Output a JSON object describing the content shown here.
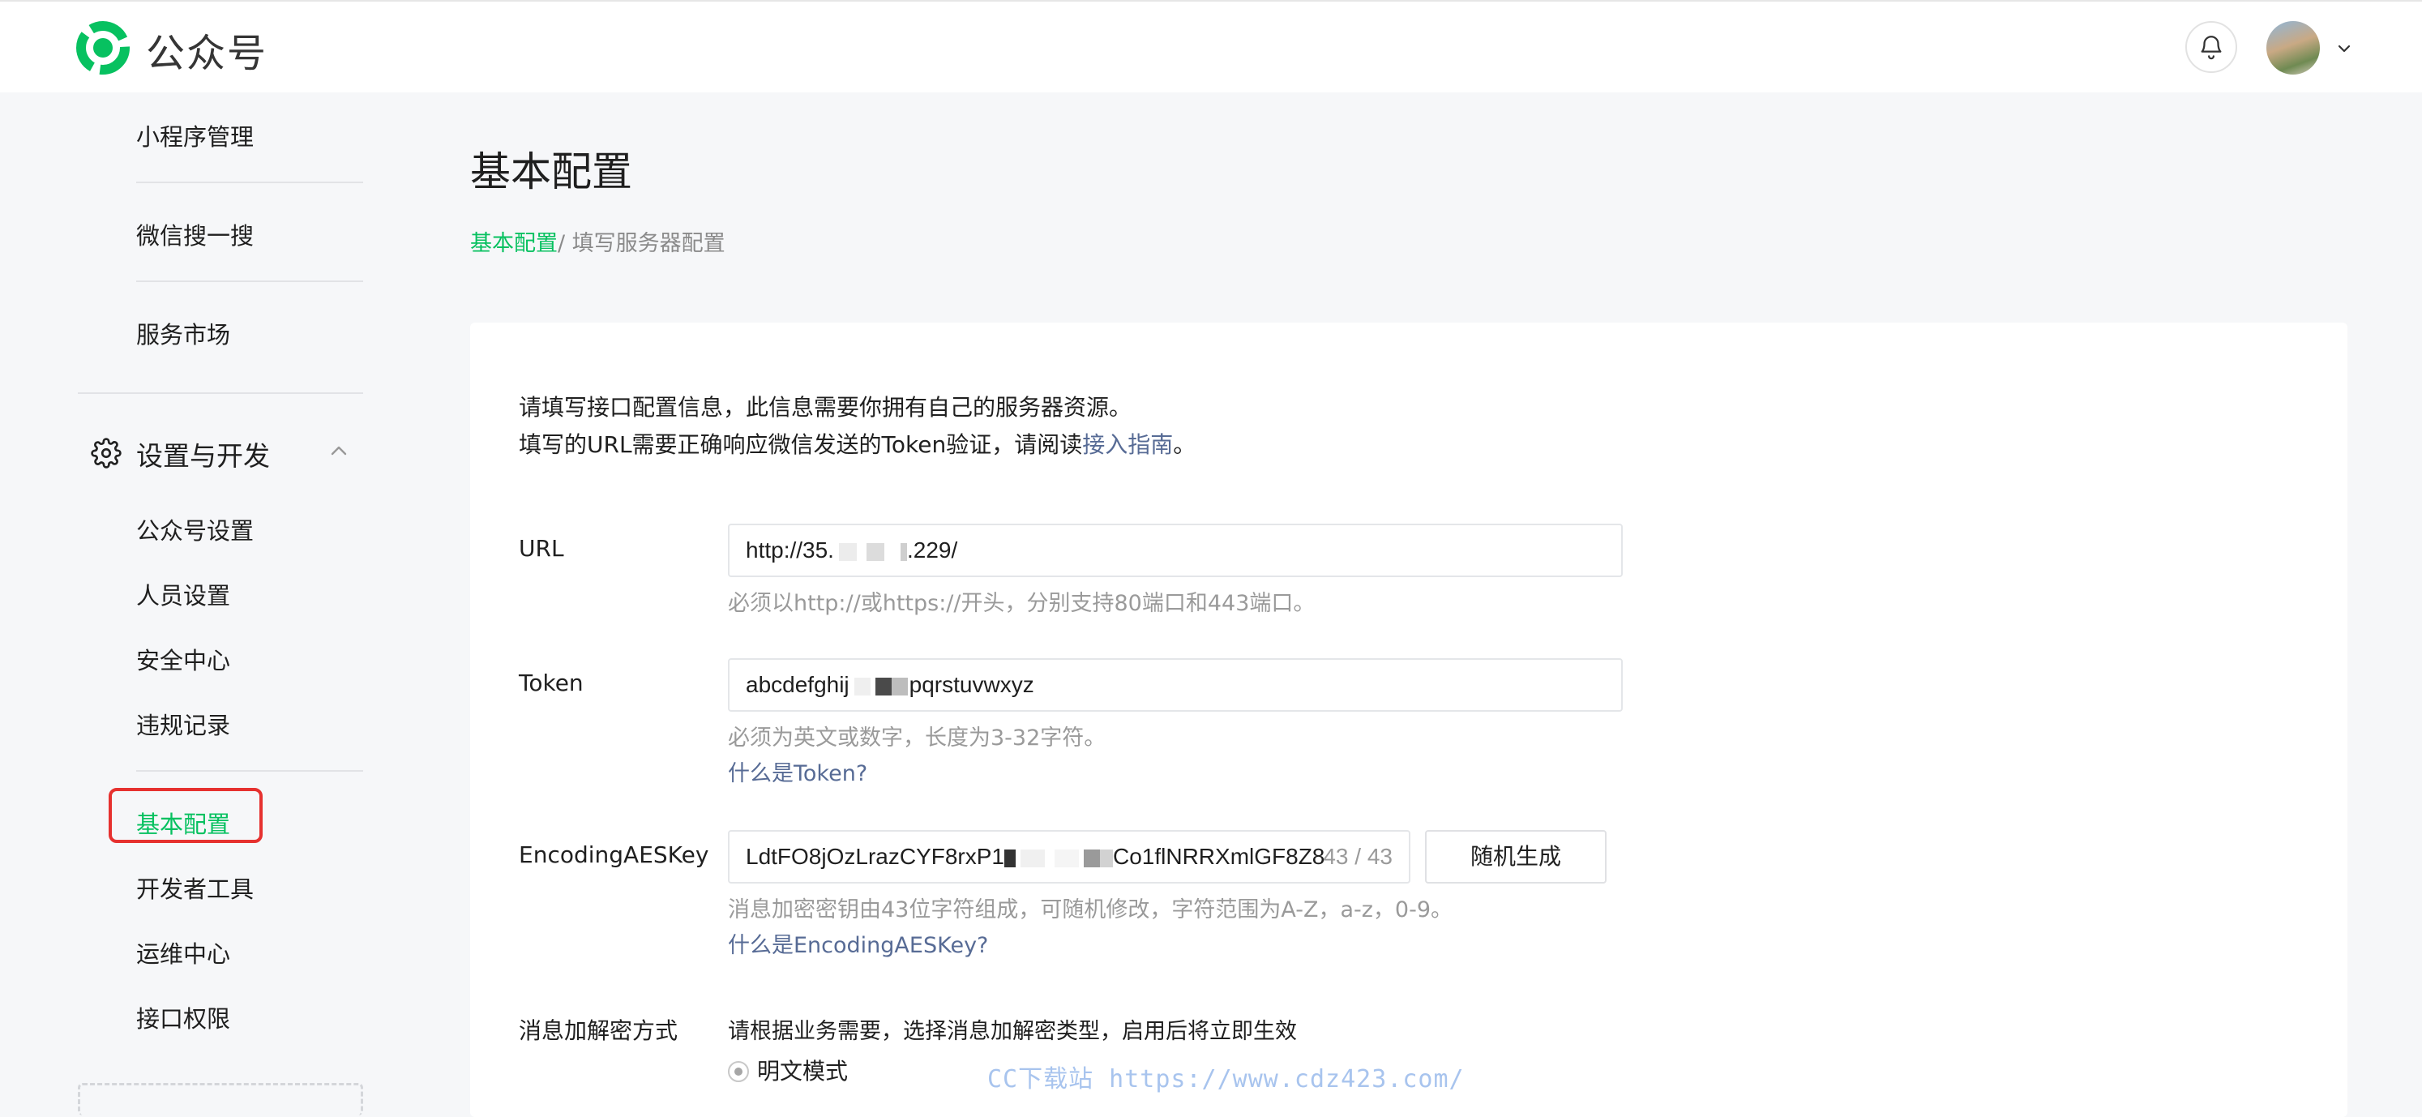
{
  "header": {
    "app_name": "公众号",
    "brand_color": "#07c160",
    "bell_icon": "bell-icon",
    "avatar_icon": "avatar"
  },
  "sidebar": {
    "top_items": [
      {
        "label": "小程序管理"
      },
      {
        "label": "微信搜一搜"
      },
      {
        "label": "服务市场"
      }
    ],
    "section": {
      "label": "设置与开发",
      "icon": "gear-icon",
      "expanded": true
    },
    "group1": [
      {
        "label": "公众号设置"
      },
      {
        "label": "人员设置"
      },
      {
        "label": "安全中心"
      },
      {
        "label": "违规记录"
      }
    ],
    "group2": [
      {
        "label": "基本配置",
        "active": true
      },
      {
        "label": "开发者工具"
      },
      {
        "label": "运维中心"
      },
      {
        "label": "接口权限"
      }
    ],
    "active_color": "#07c160",
    "highlight_color": "#e6312f"
  },
  "main": {
    "title": "基本配置",
    "breadcrumb": {
      "link": "基本配置",
      "separator": "/ ",
      "current": "填写服务器配置"
    },
    "intro": {
      "line1": "请填写接口配置信息，此信息需要你拥有自己的服务器资源。",
      "line2_prefix": "填写的URL需要正确响应微信发送的Token验证，请阅读",
      "line2_link": "接入指南",
      "line2_suffix": "。"
    },
    "url": {
      "label": "URL",
      "value_prefix": "http://35.",
      "value_suffix": ".229/",
      "hint": "必须以http://或https://开头，分别支持80端口和443端口。"
    },
    "token": {
      "label": "Token",
      "value_prefix": "abcdefghij",
      "value_suffix": "pqrstuvwxyz",
      "hint": "必须为英文或数字，长度为3-32字符。",
      "help_link": "什么是Token?"
    },
    "aeskey": {
      "label": "EncodingAESKey",
      "value_prefix": "LdtFO8jOzLrazCYF8rxP1",
      "value_suffix": "Co1flNRRXmlGF8Z8",
      "counter": "43 / 43",
      "generate_button": "随机生成",
      "hint": "消息加密密钥由43位字符组成，可随机修改，字符范围为A-Z，a-z，0-9。",
      "help_link": "什么是EncodingAESKey?"
    },
    "encrypt_mode": {
      "label": "消息加解密方式",
      "description": "请根据业务需要，选择消息加解密类型，启用后将立即生效",
      "option1": "明文模式"
    }
  },
  "watermark": "CC下载站  https://www.cdz423.com/"
}
